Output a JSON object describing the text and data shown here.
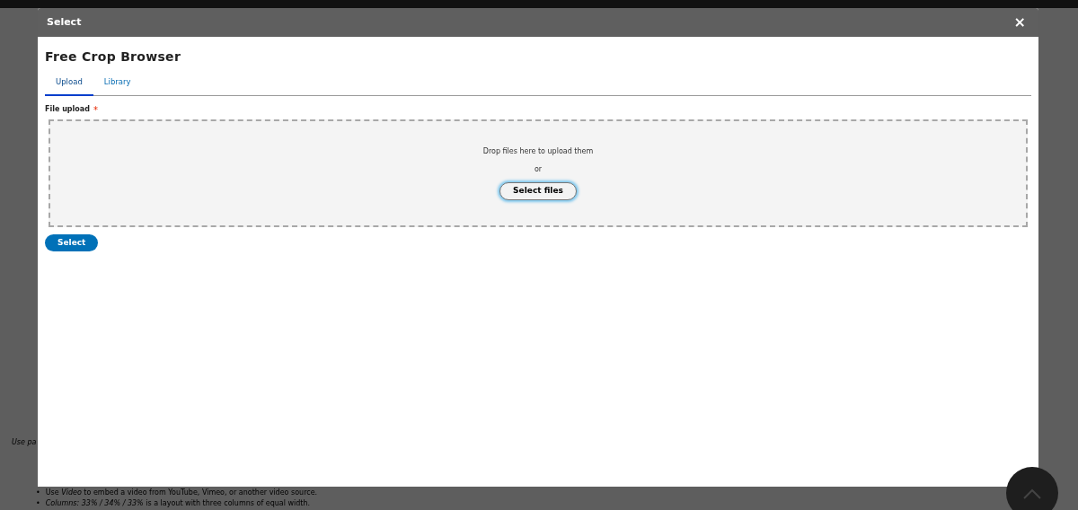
{
  "background_page": {
    "intro": "Use pa",
    "list": [
      {
        "marker": "•",
        "text": "Use *Video* to embed a video from YouTube, Vimeo, or another video source."
      },
      {
        "marker": "•",
        "text": "*Columns: 33% / 34% / 33%* is a layout with three columns of equal width."
      }
    ]
  },
  "dialog": {
    "title": "Select",
    "close": "×",
    "heading": "Free Crop Browser",
    "tabs": [
      {
        "label": "Upload",
        "selected": true
      },
      {
        "label": "Library",
        "selected": false
      }
    ],
    "field": {
      "label": "File upload",
      "required": true,
      "required_marker": "*",
      "drop_text": "Drop files here to upload them",
      "or_text": "or",
      "button": "Select files"
    },
    "submit": "Select"
  }
}
